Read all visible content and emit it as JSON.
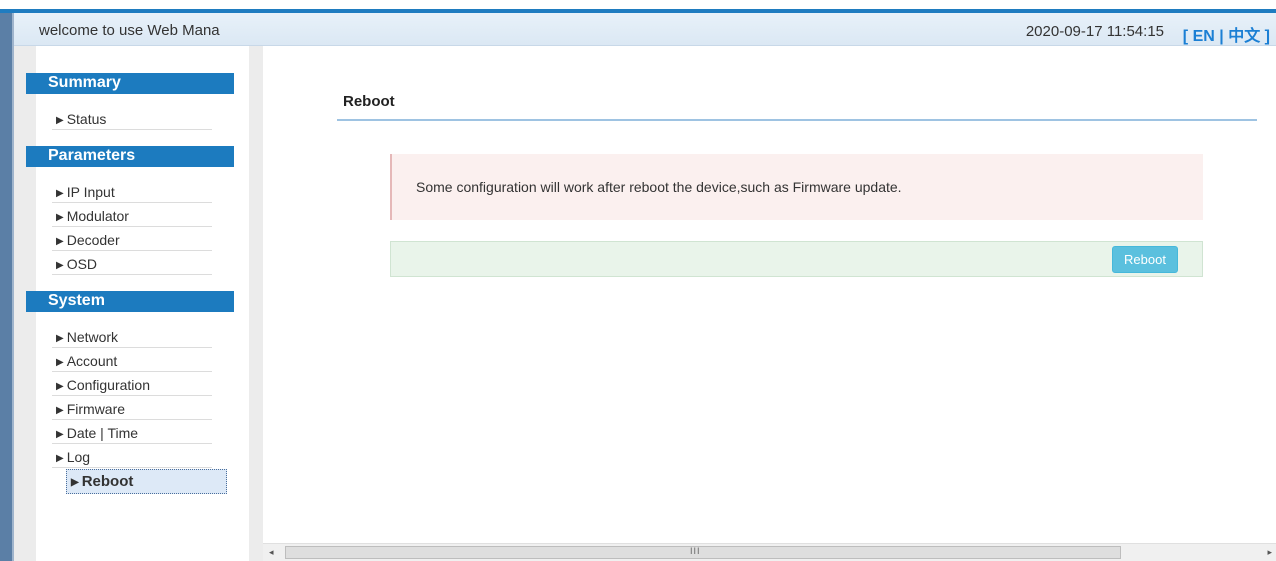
{
  "header": {
    "welcome": "welcome to use Web Mana",
    "datetime": "2020-09-17 11:54:15",
    "lang_open": "[",
    "lang_en": "EN",
    "lang_sep": "|",
    "lang_zh": "中文",
    "lang_close": "]"
  },
  "sidebar": {
    "summary": {
      "title": "Summary",
      "items": [
        "Status"
      ]
    },
    "parameters": {
      "title": "Parameters",
      "items": [
        "IP Input",
        "Modulator",
        "Decoder",
        "OSD"
      ]
    },
    "system": {
      "title": "System",
      "items": [
        "Network",
        "Account",
        "Configuration",
        "Firmware",
        "Date | Time",
        "Log",
        "Reboot"
      ],
      "active": "Reboot"
    }
  },
  "content": {
    "title": "Reboot",
    "alert": "Some configuration will work after reboot the device,such as Firmware update.",
    "button": "Reboot"
  },
  "scrollbar": {
    "left_arrow": "◂",
    "right_arrow": "▸",
    "grip": "III"
  },
  "colors": {
    "accent": "#1c7bbf",
    "button": "#5bc0de",
    "alert_bg": "#fbf0ef",
    "action_bg": "#e9f4ea"
  }
}
